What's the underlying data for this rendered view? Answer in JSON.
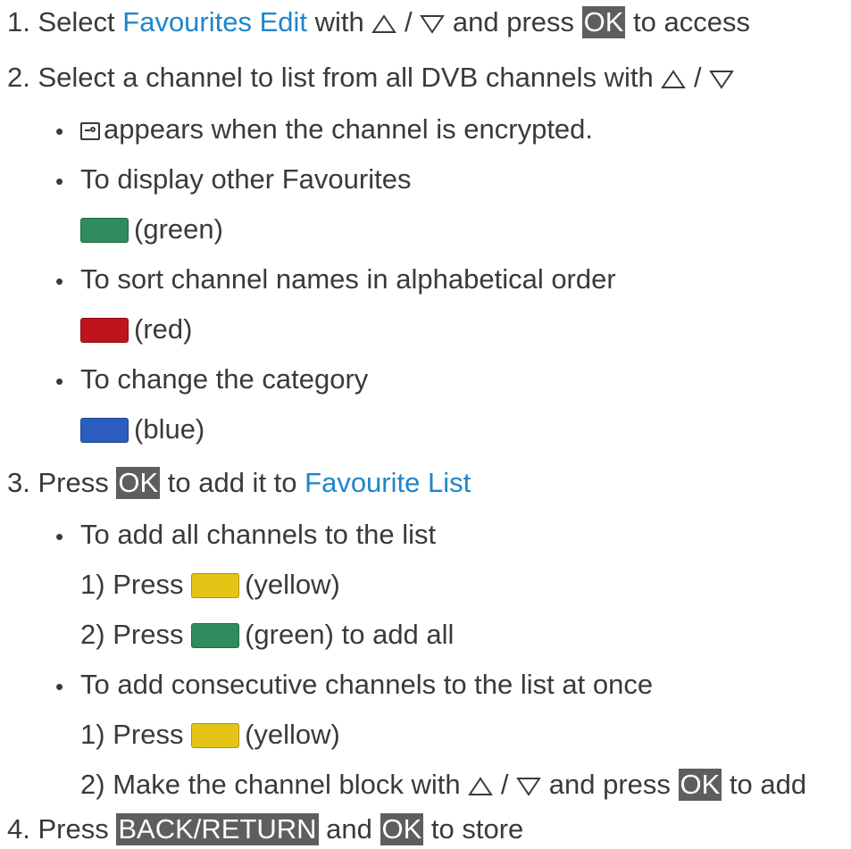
{
  "steps": {
    "s1": {
      "num": "1.",
      "pre": "Select ",
      "link": "Favourites Edit",
      "mid": " with",
      "slash": "/",
      "and": " and press ",
      "key": "OK",
      "post": " to access"
    },
    "s2": {
      "num": "2.",
      "pre": "Select a channel to list from all DVB channels with",
      "slash": "/",
      "b1": "appears when the channel is encrypted.",
      "b2": "To display other Favourites",
      "b2_btn": "(green)",
      "b3": "To sort channel names in alphabetical order",
      "b3_btn": "(red)",
      "b4": "To change the category",
      "b4_btn": "(blue)"
    },
    "s3": {
      "num": "3.",
      "pre": "Press ",
      "key": "OK",
      "mid": " to add it to ",
      "link": "Favourite List",
      "b1": "To add all channels to the list",
      "b1_1_num": "1)",
      "b1_1_pre": "Press ",
      "b1_1_btn": "(yellow)",
      "b1_2_num": "2)",
      "b1_2_pre": "Press ",
      "b1_2_btn": "(green) to add all",
      "b2": "To add consecutive channels to the list at once",
      "b2_1_num": "1)",
      "b2_1_pre": "Press ",
      "b2_1_btn": "(yellow)",
      "b2_2_num": "2)",
      "b2_2_pre": "Make the channel block with",
      "b2_2_slash": "/",
      "b2_2_and": " and press ",
      "b2_2_key": "OK",
      "b2_2_post": " to add"
    },
    "s4": {
      "num": "4.",
      "pre": "Press ",
      "key1": "BACK/RETURN",
      "and": " and ",
      "key2": "OK",
      "post": " to store"
    }
  },
  "bullet_glyph": "•",
  "colors": {
    "green": "#2e8c5d",
    "red": "#c0141d",
    "blue": "#2a5dbf",
    "yellow": "#e6c415",
    "link": "#1f86c8",
    "key_bg": "#5e5e5e"
  },
  "icons": {
    "up": "up-triangle-icon",
    "down": "down-triangle-icon",
    "lock": "encrypted-lock-icon"
  }
}
